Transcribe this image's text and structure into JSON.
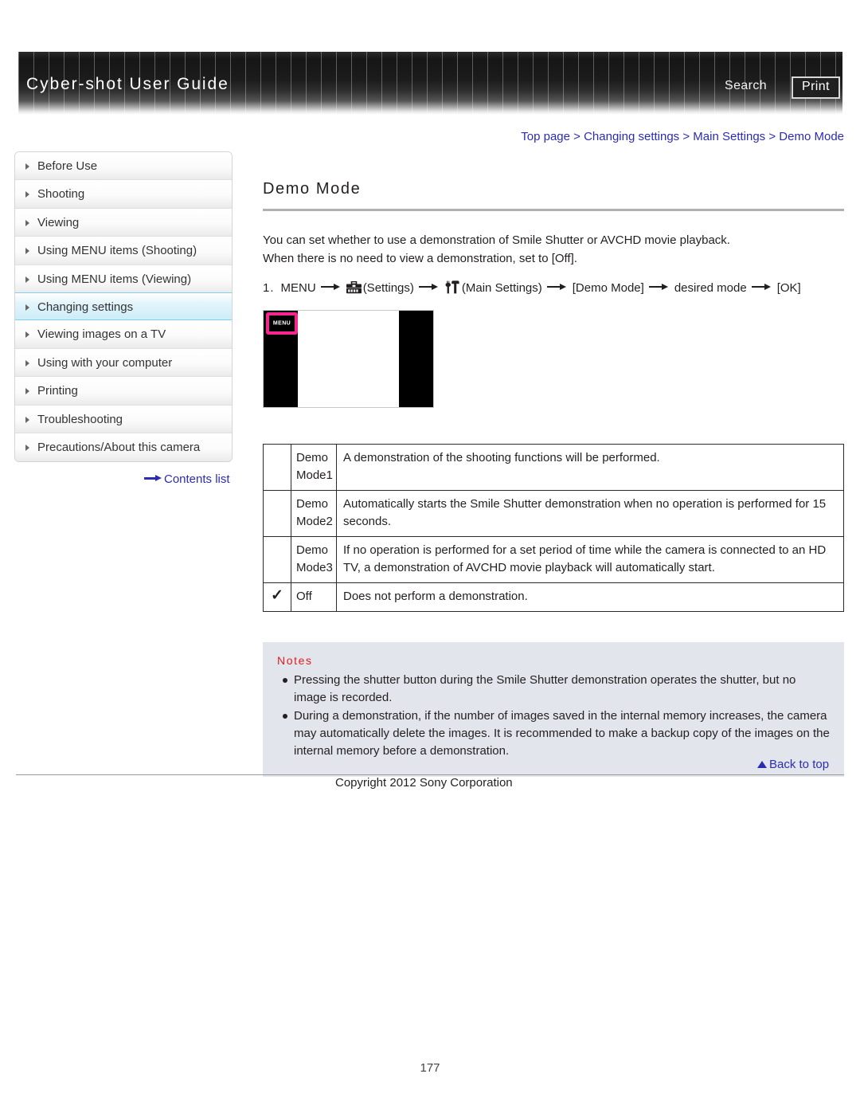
{
  "header": {
    "title": "Cyber-shot User Guide",
    "search_label": "Search",
    "print_label": "Print"
  },
  "breadcrumb": {
    "separator": ">",
    "items": [
      {
        "label": "Top page"
      },
      {
        "label": "Changing settings"
      },
      {
        "label": "Main Settings"
      },
      {
        "label": "Demo Mode"
      }
    ]
  },
  "sidebar": {
    "items": [
      {
        "label": "Before Use",
        "active": false
      },
      {
        "label": "Shooting",
        "active": false
      },
      {
        "label": "Viewing",
        "active": false
      },
      {
        "label": "Using MENU items (Shooting)",
        "active": false
      },
      {
        "label": "Using MENU items (Viewing)",
        "active": false
      },
      {
        "label": "Changing settings",
        "active": true
      },
      {
        "label": "Viewing images on a TV",
        "active": false
      },
      {
        "label": "Using with your computer",
        "active": false
      },
      {
        "label": "Printing",
        "active": false
      },
      {
        "label": "Troubleshooting",
        "active": false
      },
      {
        "label": "Precautions/About this camera",
        "active": false
      }
    ],
    "contents_list_label": "Contents list"
  },
  "main": {
    "page_title": "Demo Mode",
    "intro_line_1": "You can set whether to use a demonstration of Smile Shutter or AVCHD movie playback.",
    "intro_line_2": "When there is no need to view a demonstration, set to [Off].",
    "step": {
      "number": "1.",
      "menu_label": "MENU",
      "settings_label": "(Settings)",
      "main_settings_label": "(Main Settings)",
      "demo_mode_label": "[Demo Mode]",
      "desired_mode_label": "desired mode",
      "ok_label": "[OK]"
    },
    "illustration": {
      "menu_button_label": "MENU",
      "highlight_color": "#f7268f"
    },
    "table": {
      "rows": [
        {
          "checked": "",
          "name": "Demo Mode1",
          "description": "A demonstration of the shooting functions will be performed."
        },
        {
          "checked": "",
          "name": "Demo Mode2",
          "description": "Automatically starts the Smile Shutter demonstration when no operation is performed for 15 seconds."
        },
        {
          "checked": "",
          "name": "Demo Mode3",
          "description": "If no operation is performed for a set period of time while the camera is connected to an HD TV, a demonstration of AVCHD movie playback will automatically start."
        },
        {
          "checked": "✓",
          "name": "Off",
          "description": "Does not perform a demonstration."
        }
      ]
    },
    "notes": {
      "heading": "Notes",
      "items": [
        "Pressing the shutter button during the Smile Shutter demonstration operates the shutter, but no image is recorded.",
        "During a demonstration, if the number of images saved in the internal memory increases, the camera may automatically delete the images. It is recommended to make a backup copy of the images on the internal memory before a demonstration."
      ]
    }
  },
  "footer": {
    "back_to_top_label": "Back to top",
    "copyright": "Copyright 2012 Sony Corporation",
    "page_number": "177"
  },
  "colors": {
    "link": "#2c2cb0",
    "notes_heading": "#e01b1b",
    "notes_background": "#e2e6ec",
    "sidebar_active": "#ccedf8"
  }
}
